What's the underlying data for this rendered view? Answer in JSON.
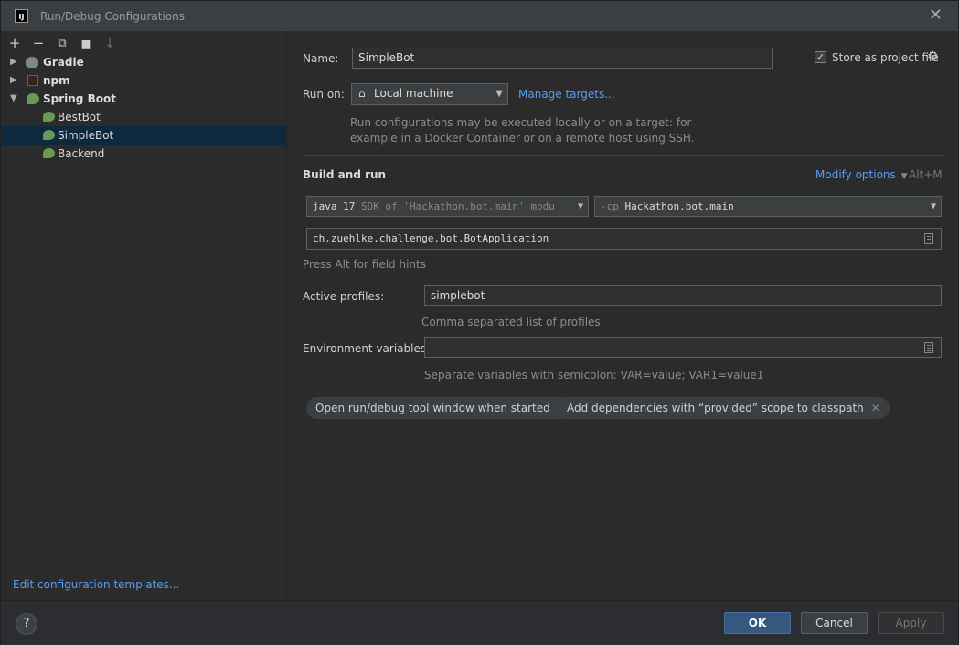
{
  "window": {
    "title": "Run/Debug Configurations",
    "app_icon_text": "IJ"
  },
  "toolbar": {
    "add": "+",
    "remove": "−",
    "copy": "⧉",
    "folder": "▆",
    "sort": "↓"
  },
  "tree": [
    {
      "label": "Gradle",
      "expanded": false,
      "icon": "gradle-icon"
    },
    {
      "label": "npm",
      "expanded": false,
      "icon": "npm-icon"
    },
    {
      "label": "Spring Boot",
      "expanded": true,
      "icon": "spring-boot-icon",
      "children": [
        {
          "label": "BestBot",
          "selected": false
        },
        {
          "label": "SimpleBot",
          "selected": true
        },
        {
          "label": "Backend",
          "selected": false
        }
      ]
    }
  ],
  "edit_templates": "Edit configuration templates...",
  "form": {
    "name_label": "Name:",
    "name_value": "SimpleBot",
    "store_label": "Store as project file",
    "store_checked": true,
    "run_on_label": "Run on:",
    "run_on_value": "Local machine",
    "manage_targets": "Manage targets...",
    "run_on_hint_1": "Run configurations may be executed locally or on a target: for",
    "run_on_hint_2": "example in a Docker Container or on a remote host using SSH.",
    "build_and_run": "Build and run",
    "modify_options": "Modify options",
    "modify_shortcut": "Alt+M",
    "jdk_prefix": "java 17",
    "jdk_detail": "SDK of 'Hackathon.bot.main' modu",
    "cp_prefix": "-cp",
    "cp_value": "Hackathon.bot.main",
    "main_class": "ch.zuehlke.challenge.bot.BotApplication",
    "field_hints": "Press Alt for field hints",
    "active_profiles_label": "Active profiles:",
    "active_profiles_value": "simplebot",
    "active_profiles_hint": "Comma separated list of profiles",
    "env_label": "Environment variables:",
    "env_value": "",
    "env_hint": "Separate variables with semicolon: VAR=value; VAR1=value1",
    "chips": [
      "Open run/debug tool window when started",
      "Add dependencies with “provided” scope to classpath"
    ]
  },
  "footer": {
    "help": "?",
    "ok": "OK",
    "cancel": "Cancel",
    "apply": "Apply"
  }
}
